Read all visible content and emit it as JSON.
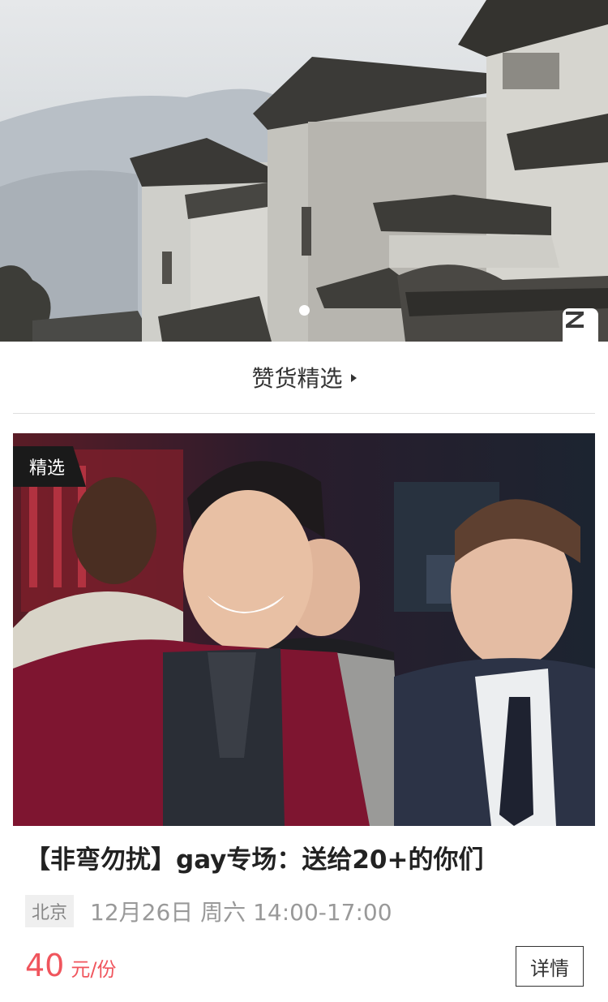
{
  "banner": {
    "image_alt": "Hui-style architecture rooftops",
    "slide_count": 1,
    "active_slide": 1,
    "watermark": "Z"
  },
  "section": {
    "title": "赞货精选"
  },
  "event": {
    "tag": "精选",
    "title": "【非弯勿扰】gay专场：送给20+的你们",
    "city": "北京",
    "time": "12月26日 周六 14:00-17:00",
    "price": "40",
    "price_unit": "元/份",
    "detail_label": "详情"
  },
  "colors": {
    "price": "#f0555d",
    "tag_bg": "#1a1a1a",
    "divider": "#dedede"
  }
}
